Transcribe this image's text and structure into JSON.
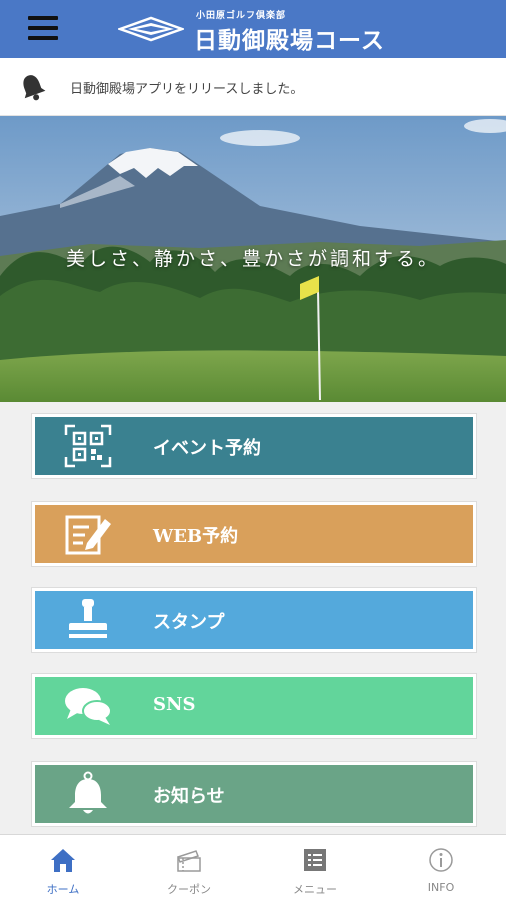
{
  "header": {
    "logo_sub": "小田原ゴルフ倶楽部",
    "logo_main": "日動御殿場コース"
  },
  "notice": {
    "text": "日動御殿場アプリをリリースしました。",
    "icon": "bell-icon"
  },
  "hero": {
    "tagline": "美しさ、静かさ、豊かさが調和する。"
  },
  "menu": {
    "items": [
      {
        "label": "イベント予約",
        "icon": "qr-code-icon",
        "color": "#3a8190"
      },
      {
        "label": "WEB予約",
        "icon": "edit-form-icon",
        "color": "#d9a05b"
      },
      {
        "label": "スタンプ",
        "icon": "stamp-icon",
        "color": "#54a9dc"
      },
      {
        "label": "SNS",
        "icon": "chat-bubbles-icon",
        "color": "#62d59b"
      },
      {
        "label": "お知らせ",
        "icon": "bell-icon",
        "color": "#6aa487"
      }
    ]
  },
  "tabbar": {
    "items": [
      {
        "label": "ホーム",
        "icon": "home-icon",
        "active": true
      },
      {
        "label": "クーポン",
        "icon": "coupon-icon",
        "active": false
      },
      {
        "label": "メニュー",
        "icon": "list-icon",
        "active": false
      },
      {
        "label": "INFO",
        "icon": "info-icon",
        "active": false
      }
    ]
  },
  "colors": {
    "header": "#4a78c6",
    "tab_active": "#3e6fc4"
  }
}
